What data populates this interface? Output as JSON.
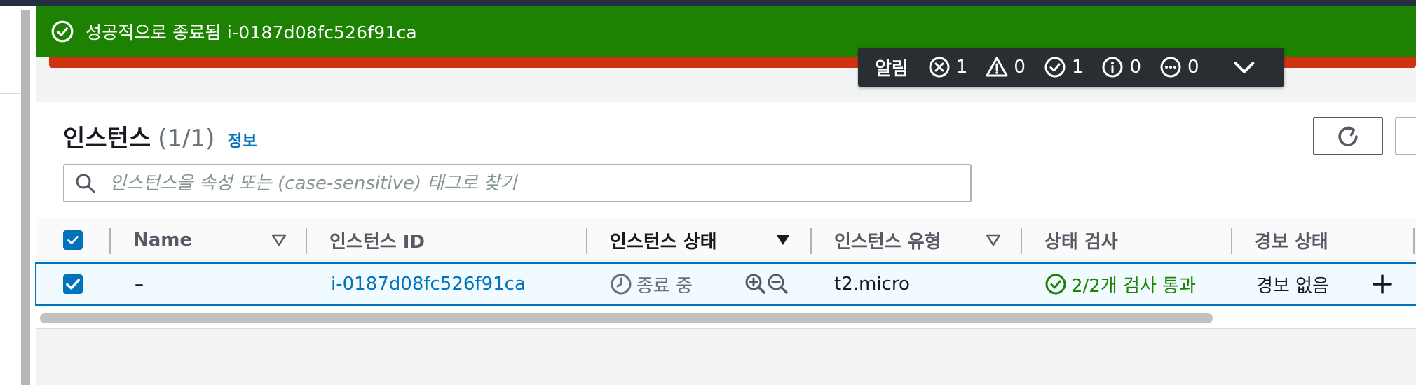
{
  "flash": {
    "message": "성공적으로 종료됨 i-0187d08fc526f91ca",
    "status_color": "#1d8102",
    "icon": "check-circle-icon"
  },
  "notifications": {
    "title": "알림",
    "error_count": "1",
    "warning_count": "0",
    "success_count": "1",
    "info_count": "0",
    "in_progress_count": "0"
  },
  "instances": {
    "title": "인스턴스",
    "count": "(1/1)",
    "info_link": "정보"
  },
  "search": {
    "placeholder": "인스턴스을 속성 또는 (case-sensitive) 태그로 찾기"
  },
  "table": {
    "columns": [
      "Name",
      "인스턴스 ID",
      "인스턴스 상태",
      "인스턴스 유형",
      "상태 검사",
      "경보 상태"
    ],
    "rows": [
      {
        "name": "–",
        "instance_id": "i-0187d08fc526f91ca",
        "state": "종료 중",
        "type": "t2.micro",
        "status_check": "2/2개 검사 통과",
        "alarm_status": "경보 없음"
      }
    ]
  },
  "colors": {
    "link": "#0073bb",
    "success": "#1d8102",
    "error_strip": "#d13212",
    "header_bar": "#232f3e"
  }
}
